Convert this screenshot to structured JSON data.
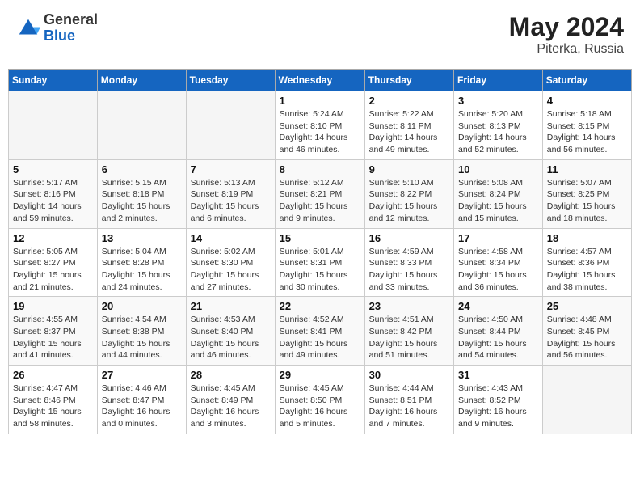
{
  "header": {
    "logo_general": "General",
    "logo_blue": "Blue",
    "month_year": "May 2024",
    "location": "Piterka, Russia"
  },
  "days_of_week": [
    "Sunday",
    "Monday",
    "Tuesday",
    "Wednesday",
    "Thursday",
    "Friday",
    "Saturday"
  ],
  "weeks": [
    [
      {
        "day": "",
        "sunrise": "",
        "sunset": "",
        "daylight": ""
      },
      {
        "day": "",
        "sunrise": "",
        "sunset": "",
        "daylight": ""
      },
      {
        "day": "",
        "sunrise": "",
        "sunset": "",
        "daylight": ""
      },
      {
        "day": "1",
        "sunrise": "5:24 AM",
        "sunset": "8:10 PM",
        "daylight": "14 hours and 46 minutes."
      },
      {
        "day": "2",
        "sunrise": "5:22 AM",
        "sunset": "8:11 PM",
        "daylight": "14 hours and 49 minutes."
      },
      {
        "day": "3",
        "sunrise": "5:20 AM",
        "sunset": "8:13 PM",
        "daylight": "14 hours and 52 minutes."
      },
      {
        "day": "4",
        "sunrise": "5:18 AM",
        "sunset": "8:15 PM",
        "daylight": "14 hours and 56 minutes."
      }
    ],
    [
      {
        "day": "5",
        "sunrise": "5:17 AM",
        "sunset": "8:16 PM",
        "daylight": "14 hours and 59 minutes."
      },
      {
        "day": "6",
        "sunrise": "5:15 AM",
        "sunset": "8:18 PM",
        "daylight": "15 hours and 2 minutes."
      },
      {
        "day": "7",
        "sunrise": "5:13 AM",
        "sunset": "8:19 PM",
        "daylight": "15 hours and 6 minutes."
      },
      {
        "day": "8",
        "sunrise": "5:12 AM",
        "sunset": "8:21 PM",
        "daylight": "15 hours and 9 minutes."
      },
      {
        "day": "9",
        "sunrise": "5:10 AM",
        "sunset": "8:22 PM",
        "daylight": "15 hours and 12 minutes."
      },
      {
        "day": "10",
        "sunrise": "5:08 AM",
        "sunset": "8:24 PM",
        "daylight": "15 hours and 15 minutes."
      },
      {
        "day": "11",
        "sunrise": "5:07 AM",
        "sunset": "8:25 PM",
        "daylight": "15 hours and 18 minutes."
      }
    ],
    [
      {
        "day": "12",
        "sunrise": "5:05 AM",
        "sunset": "8:27 PM",
        "daylight": "15 hours and 21 minutes."
      },
      {
        "day": "13",
        "sunrise": "5:04 AM",
        "sunset": "8:28 PM",
        "daylight": "15 hours and 24 minutes."
      },
      {
        "day": "14",
        "sunrise": "5:02 AM",
        "sunset": "8:30 PM",
        "daylight": "15 hours and 27 minutes."
      },
      {
        "day": "15",
        "sunrise": "5:01 AM",
        "sunset": "8:31 PM",
        "daylight": "15 hours and 30 minutes."
      },
      {
        "day": "16",
        "sunrise": "4:59 AM",
        "sunset": "8:33 PM",
        "daylight": "15 hours and 33 minutes."
      },
      {
        "day": "17",
        "sunrise": "4:58 AM",
        "sunset": "8:34 PM",
        "daylight": "15 hours and 36 minutes."
      },
      {
        "day": "18",
        "sunrise": "4:57 AM",
        "sunset": "8:36 PM",
        "daylight": "15 hours and 38 minutes."
      }
    ],
    [
      {
        "day": "19",
        "sunrise": "4:55 AM",
        "sunset": "8:37 PM",
        "daylight": "15 hours and 41 minutes."
      },
      {
        "day": "20",
        "sunrise": "4:54 AM",
        "sunset": "8:38 PM",
        "daylight": "15 hours and 44 minutes."
      },
      {
        "day": "21",
        "sunrise": "4:53 AM",
        "sunset": "8:40 PM",
        "daylight": "15 hours and 46 minutes."
      },
      {
        "day": "22",
        "sunrise": "4:52 AM",
        "sunset": "8:41 PM",
        "daylight": "15 hours and 49 minutes."
      },
      {
        "day": "23",
        "sunrise": "4:51 AM",
        "sunset": "8:42 PM",
        "daylight": "15 hours and 51 minutes."
      },
      {
        "day": "24",
        "sunrise": "4:50 AM",
        "sunset": "8:44 PM",
        "daylight": "15 hours and 54 minutes."
      },
      {
        "day": "25",
        "sunrise": "4:48 AM",
        "sunset": "8:45 PM",
        "daylight": "15 hours and 56 minutes."
      }
    ],
    [
      {
        "day": "26",
        "sunrise": "4:47 AM",
        "sunset": "8:46 PM",
        "daylight": "15 hours and 58 minutes."
      },
      {
        "day": "27",
        "sunrise": "4:46 AM",
        "sunset": "8:47 PM",
        "daylight": "16 hours and 0 minutes."
      },
      {
        "day": "28",
        "sunrise": "4:45 AM",
        "sunset": "8:49 PM",
        "daylight": "16 hours and 3 minutes."
      },
      {
        "day": "29",
        "sunrise": "4:45 AM",
        "sunset": "8:50 PM",
        "daylight": "16 hours and 5 minutes."
      },
      {
        "day": "30",
        "sunrise": "4:44 AM",
        "sunset": "8:51 PM",
        "daylight": "16 hours and 7 minutes."
      },
      {
        "day": "31",
        "sunrise": "4:43 AM",
        "sunset": "8:52 PM",
        "daylight": "16 hours and 9 minutes."
      },
      {
        "day": "",
        "sunrise": "",
        "sunset": "",
        "daylight": ""
      }
    ]
  ]
}
